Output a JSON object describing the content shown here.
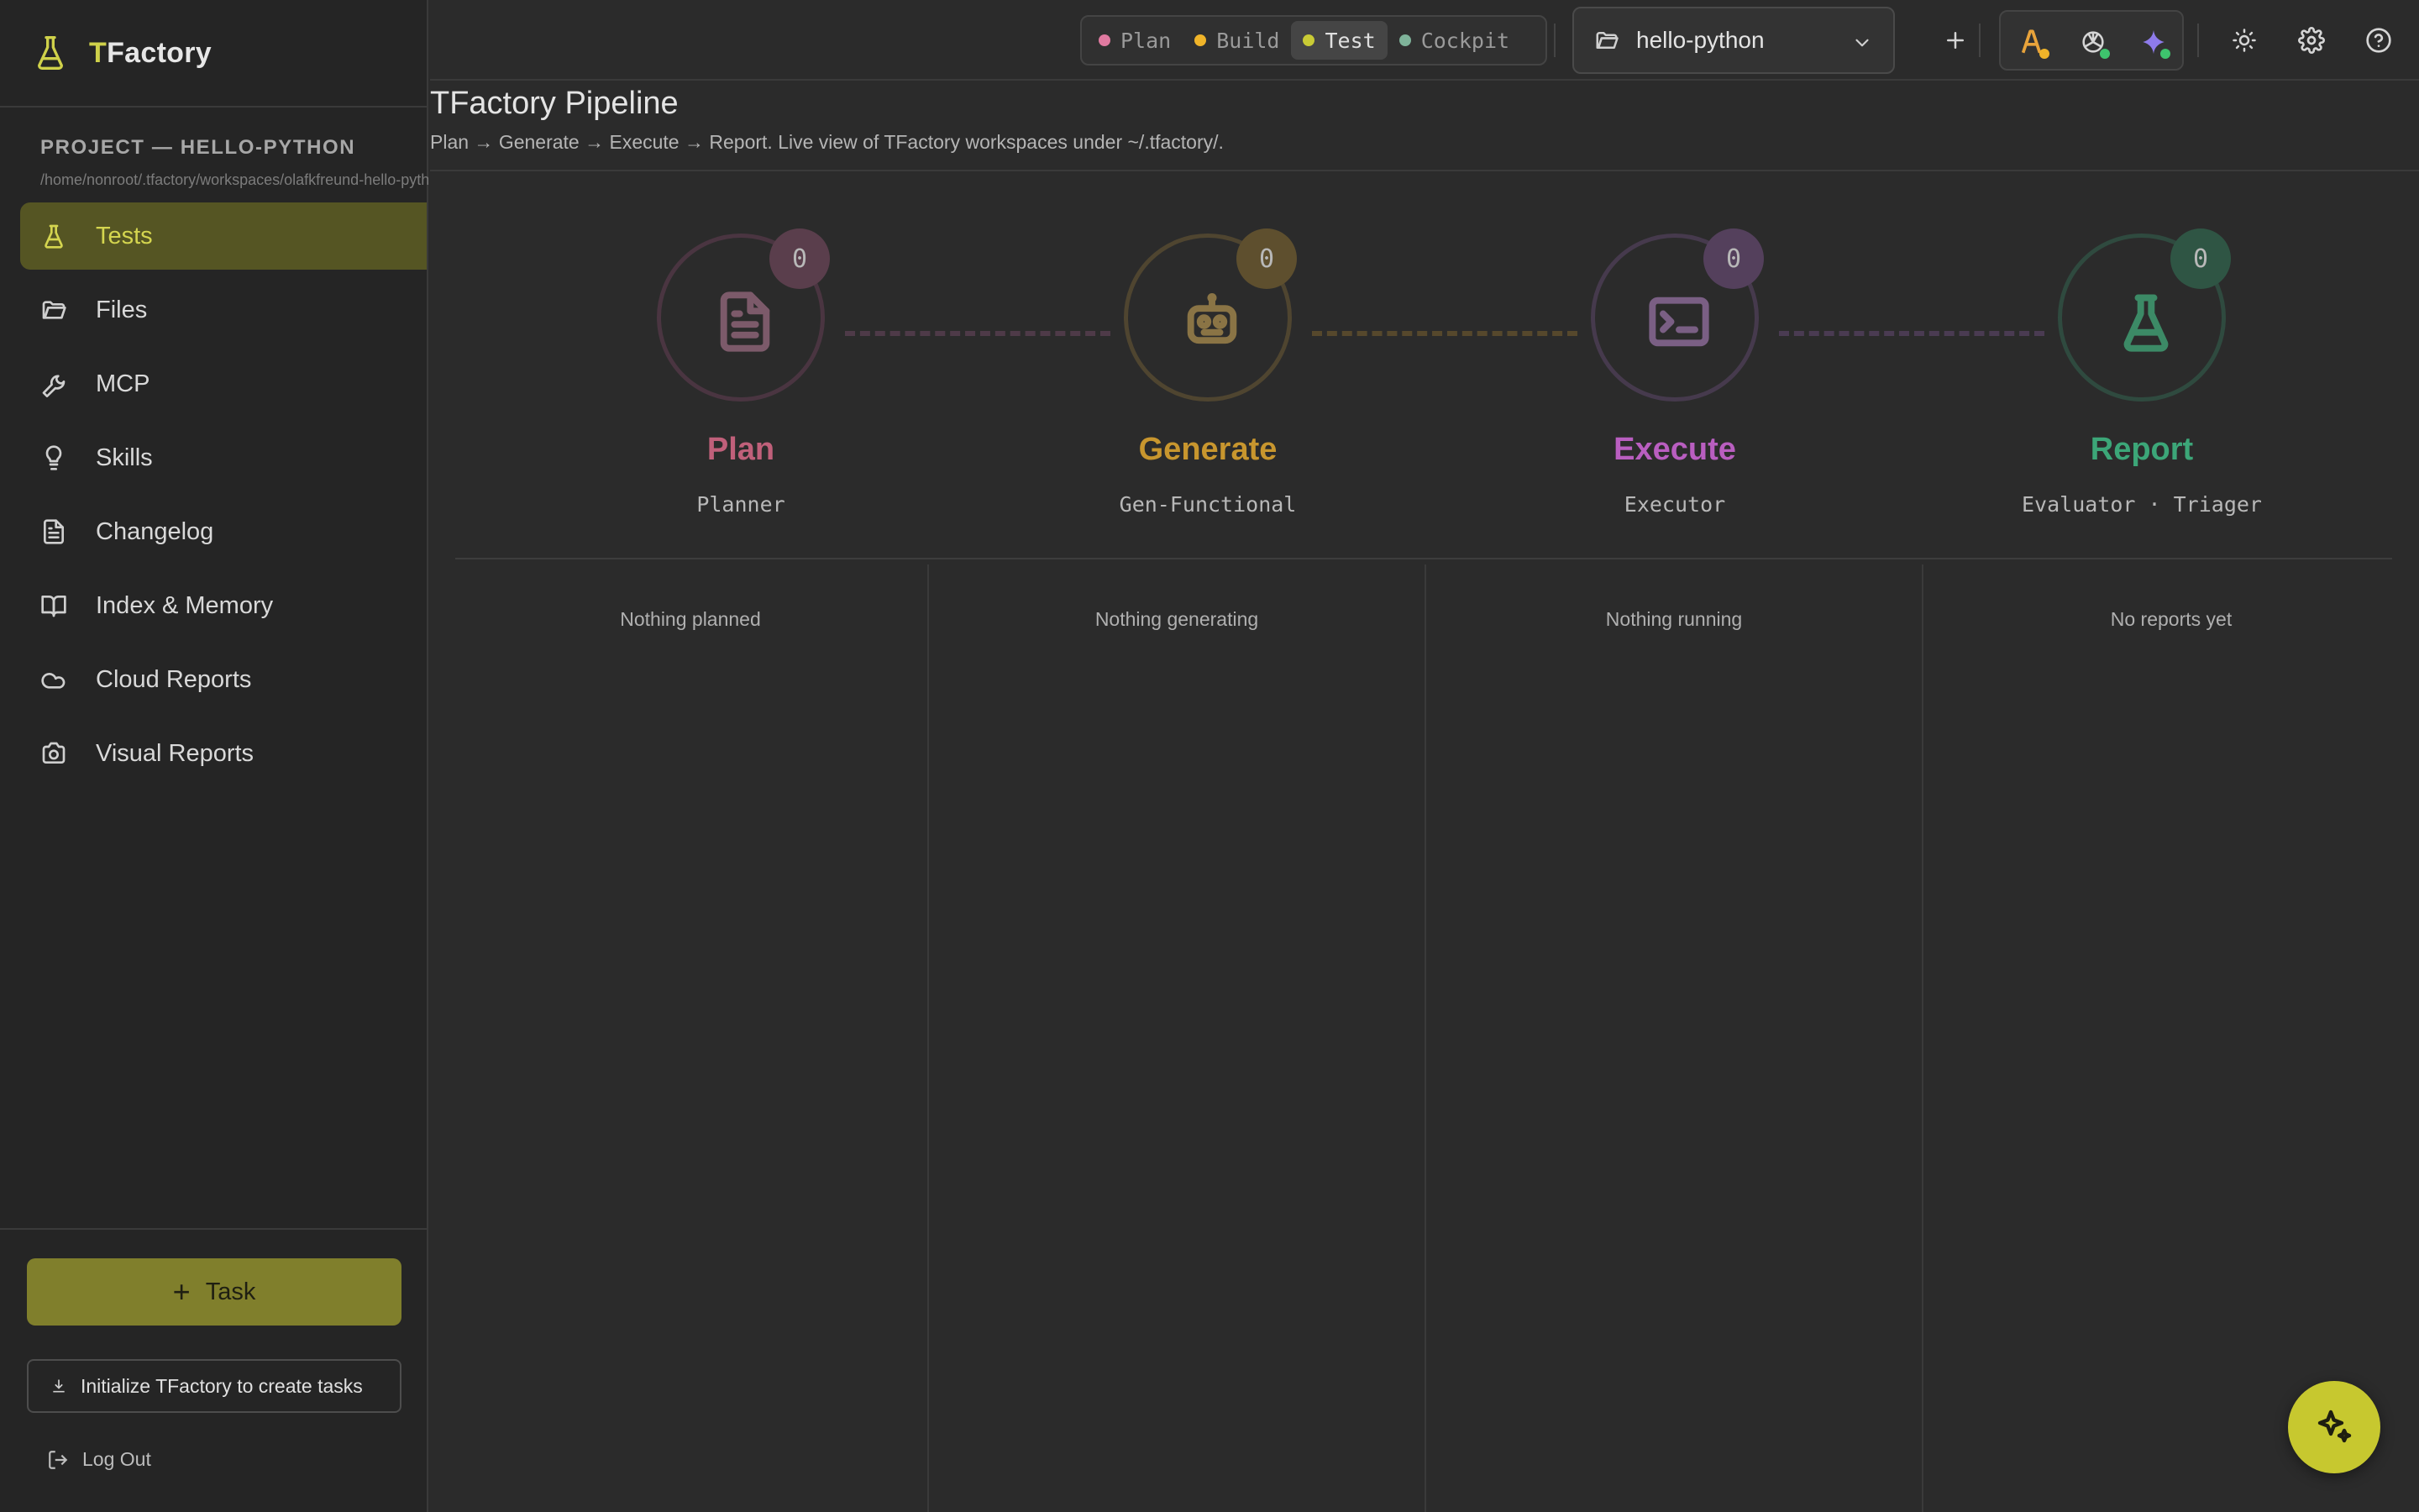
{
  "app": {
    "name_first": "T",
    "name_rest": "Factory",
    "logo_icon": "flask-icon"
  },
  "project": {
    "title": "PROJECT — HELLO-PYTHON",
    "path": "/home/nonroot/.tfactory/workspaces/olafkfreund-hello-python"
  },
  "sidebar": {
    "items": [
      {
        "label": "Tests",
        "icon": "flask-icon",
        "active": true
      },
      {
        "label": "Files",
        "icon": "folder-icon"
      },
      {
        "label": "MCP",
        "icon": "wrench-icon"
      },
      {
        "label": "Skills",
        "icon": "lightbulb-icon"
      },
      {
        "label": "Changelog",
        "icon": "document-icon"
      },
      {
        "label": "Index & Memory",
        "icon": "book-icon"
      },
      {
        "label": "Cloud Reports",
        "icon": "cloud-icon"
      },
      {
        "label": "Visual Reports",
        "icon": "camera-icon"
      }
    ],
    "task_button": "Task",
    "init_button": "Initialize TFactory to create tasks",
    "logout": "Log Out"
  },
  "topbar": {
    "modes": [
      {
        "label": "Plan",
        "color": "#e07aa0"
      },
      {
        "label": "Build",
        "color": "#f0b429"
      },
      {
        "label": "Test",
        "color": "#c9cb35",
        "active": true
      },
      {
        "label": "Cockpit",
        "color": "#7fb39a"
      }
    ],
    "project_select": "hello-python"
  },
  "main": {
    "title": "TFactory Pipeline",
    "subtitle": "Plan → Generate → Execute → Report. Live view of TFactory workspaces under ~/.tfactory/.",
    "stages": [
      {
        "name": "Plan",
        "role": "Planner",
        "count": "0",
        "color": "#c0607a",
        "empty": "Nothing planned"
      },
      {
        "name": "Generate",
        "role": "Gen-Functional",
        "count": "0",
        "color": "#c8962e",
        "empty": "Nothing generating"
      },
      {
        "name": "Execute",
        "role": "Executor",
        "count": "0",
        "color": "#b95ec0",
        "empty": "Nothing running"
      },
      {
        "name": "Report",
        "role": "Evaluator · Triager",
        "count": "0",
        "color": "#3ca678",
        "empty": "No reports yet"
      }
    ]
  }
}
